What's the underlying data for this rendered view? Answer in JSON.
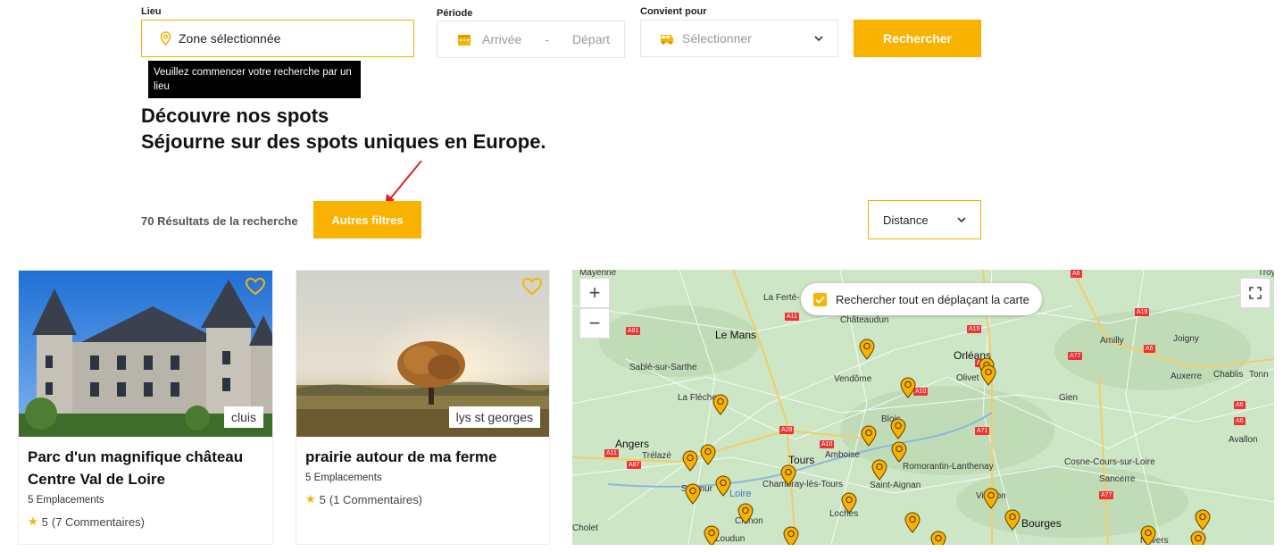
{
  "search": {
    "lieu_label": "Lieu",
    "lieu_value": "Zone sélectionnée",
    "periode_label": "Période",
    "arrivee": "Arrivée",
    "separator": "-",
    "depart": "Départ",
    "convient_label": "Convient pour",
    "convient_value": "Sélectionner",
    "search_button": "Rechercher",
    "tooltip": "Veuillez commencer votre recherche par un lieu"
  },
  "headings": {
    "title": "Découvre nos spots",
    "subtitle": "Séjourne sur des spots uniques en Europe."
  },
  "results": {
    "count_text": "70 Résultats de la recherche",
    "filters_button": "Autres filtres",
    "sort_value": "Distance"
  },
  "cards": [
    {
      "tag": "cluis",
      "title": "Parc d'un magnifique château Centre Val de Loire",
      "sub": "5 Emplacements",
      "rating": "5",
      "comments": "(7 Commentaires)"
    },
    {
      "tag": "lys st georges",
      "title": "prairie autour de ma ferme",
      "sub": "5 Emplacements",
      "rating": "5",
      "comments": "(1 Commentaires)"
    }
  ],
  "map": {
    "toggle_label": "Rechercher tout en déplaçant la carte",
    "zoom_in": "+",
    "zoom_out": "−",
    "labels": {
      "mayenne": "Mayenne",
      "ferte": "La Ferté-",
      "chateaudun": "Châteaudun",
      "lemans": "Le Mans",
      "sable": "Sablé-sur-Sarthe",
      "laflèche": "La Flèche",
      "vendome": "Vendôme",
      "orleans": "Orléans",
      "olivet": "Olivet",
      "amilly": "Amilly",
      "joigny": "Joigny",
      "auxerre": "Auxerre",
      "chablis": "Chablis",
      "tonn": "Tonn",
      "gien": "Gien",
      "blois": "Blois",
      "angers": "Angers",
      "trelaze": "Trélazé",
      "tours": "Tours",
      "amboise": "Amboise",
      "romorantin": "Romorantin-Lanthenay",
      "cosne": "Cosne-Cours-sur-Loire",
      "sancerre": "Sancerre",
      "avallon": "Avallon",
      "saumur": "Saumur",
      "chambray": "Chambray-lès-Tours",
      "saintaignan": "Saint-Aignan",
      "loire": "Loire",
      "loches": "Loches",
      "vierzon": "Vierzon",
      "bourges": "Bourges",
      "chinon": "Chinon",
      "cholet": "Cholet",
      "loudun": "Loudun",
      "nevers": "Nevers",
      "troy": "Troy"
    },
    "roads": {
      "a11a": "A11",
      "a81": "A81",
      "a19a": "A19",
      "a19b": "A19",
      "a6a": "A6",
      "a6b": "A6",
      "a77a": "A77",
      "a10": "A10",
      "a19c": "A19",
      "a28": "A28",
      "a10b": "A10",
      "a71": "A71",
      "a11b": "A11",
      "a87": "A87",
      "a77b": "A77",
      "a6c": "A6",
      "a6d": "A6"
    }
  }
}
